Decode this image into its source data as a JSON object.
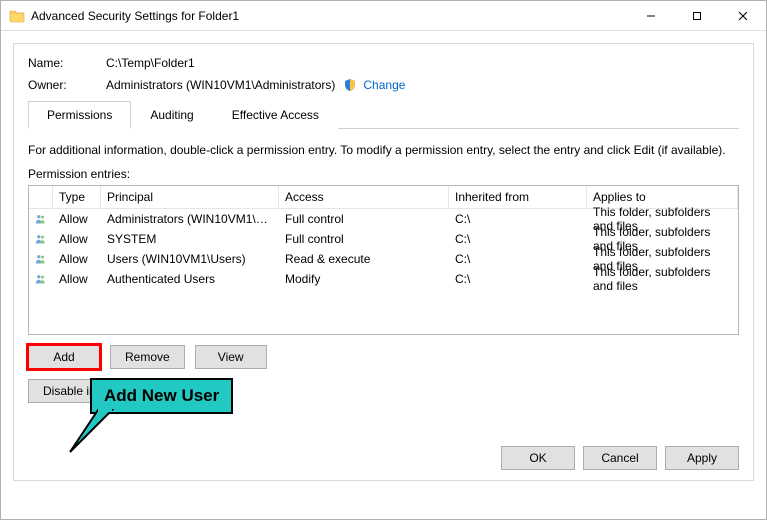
{
  "window": {
    "title": "Advanced Security Settings for Folder1"
  },
  "header": {
    "name_label": "Name:",
    "name_value": "C:\\Temp\\Folder1",
    "owner_label": "Owner:",
    "owner_value": "Administrators (WIN10VM1\\Administrators)",
    "change_link": "Change"
  },
  "tabs": {
    "permissions": "Permissions",
    "auditing": "Auditing",
    "effective": "Effective Access"
  },
  "info_text": "For additional information, double-click a permission entry. To modify a permission entry, select the entry and click Edit (if available).",
  "permission_entries_label": "Permission entries:",
  "columns": {
    "type": "Type",
    "principal": "Principal",
    "access": "Access",
    "inherited": "Inherited from",
    "applies": "Applies to"
  },
  "entries": [
    {
      "type": "Allow",
      "principal": "Administrators (WIN10VM1\\A...",
      "access": "Full control",
      "inherited": "C:\\",
      "applies": "This folder, subfolders and files"
    },
    {
      "type": "Allow",
      "principal": "SYSTEM",
      "access": "Full control",
      "inherited": "C:\\",
      "applies": "This folder, subfolders and files"
    },
    {
      "type": "Allow",
      "principal": "Users (WIN10VM1\\Users)",
      "access": "Read & execute",
      "inherited": "C:\\",
      "applies": "This folder, subfolders and files"
    },
    {
      "type": "Allow",
      "principal": "Authenticated Users",
      "access": "Modify",
      "inherited": "C:\\",
      "applies": "This folder, subfolders and files"
    }
  ],
  "buttons": {
    "add": "Add",
    "remove": "Remove",
    "view": "View",
    "disable_inheritance": "Disable inheritance",
    "ok": "OK",
    "cancel": "Cancel",
    "apply": "Apply"
  },
  "callout": {
    "text": "Add New User"
  }
}
